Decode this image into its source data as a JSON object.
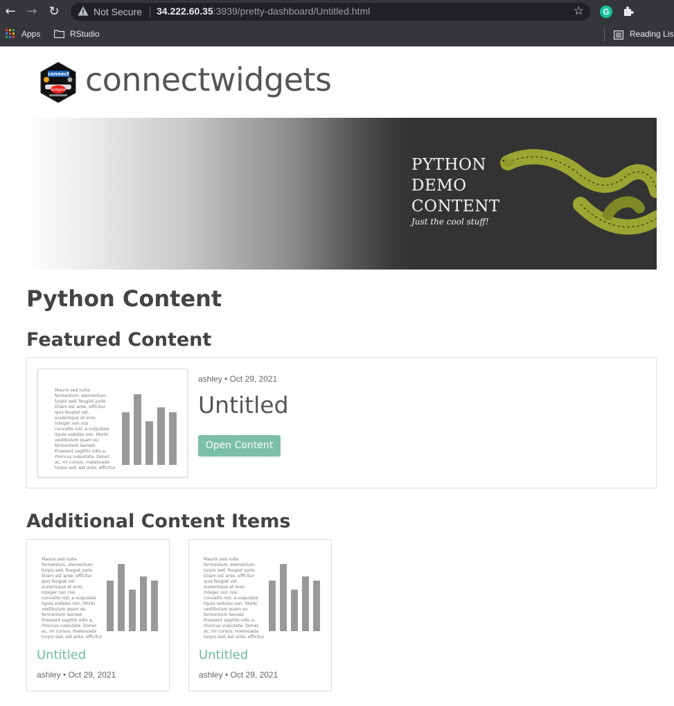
{
  "browser": {
    "security_label": "Not Secure",
    "url_host": "34.222.60.35",
    "url_rest": ":3939/pretty-dashboard/Untitled.html",
    "bookmarks": [
      {
        "label": "Apps"
      },
      {
        "label": "RStudio"
      },
      {
        "label": "Reading List"
      }
    ],
    "extension_initial": "G"
  },
  "site": {
    "brand": "connectwidgets",
    "logo_text": [
      "connect",
      "widgets"
    ]
  },
  "banner": {
    "lines": [
      "PYTHON",
      "DEMO",
      "CONTENT"
    ],
    "tagline": "Just the cool stuff!"
  },
  "page": {
    "title": "Python Content",
    "featured_heading": "Featured Content",
    "additional_heading": "Additional Content Items"
  },
  "featured": {
    "author": "ashley",
    "date": "Oct 29, 2021",
    "title": "Untitled",
    "button_label": "Open Content"
  },
  "thumbnail": {
    "lorem_lines": [
      "Mauris sed nulla",
      "fermentum, elementum",
      "turpis sed, feugiat justo.",
      "Etiam est ante, efficitur",
      "quis feugiat vel,",
      "scelerisque et eros.",
      "Integer non nisi",
      "convallis nisl, a vulputate",
      "ligula sodales non. Morbi",
      "vestibulum quam eu",
      "fermentum laoreet.",
      "Praesent sagittis odio a,",
      "rhoncus vulputate. Donec",
      "ac, mi cursus, malesuada",
      "turpis sed, est ante, efficitur"
    ],
    "bar_levels": [
      0.75,
      1.0,
      0.62,
      0.81,
      0.75
    ]
  },
  "items": [
    {
      "title": "Untitled",
      "author": "ashley",
      "date": "Oct 29, 2021"
    },
    {
      "title": "Untitled",
      "author": "ashley",
      "date": "Oct 29, 2021"
    }
  ],
  "colors": {
    "accent": "#7bbfa8",
    "link": "#6dbb9f",
    "chrome": "#35363a"
  }
}
